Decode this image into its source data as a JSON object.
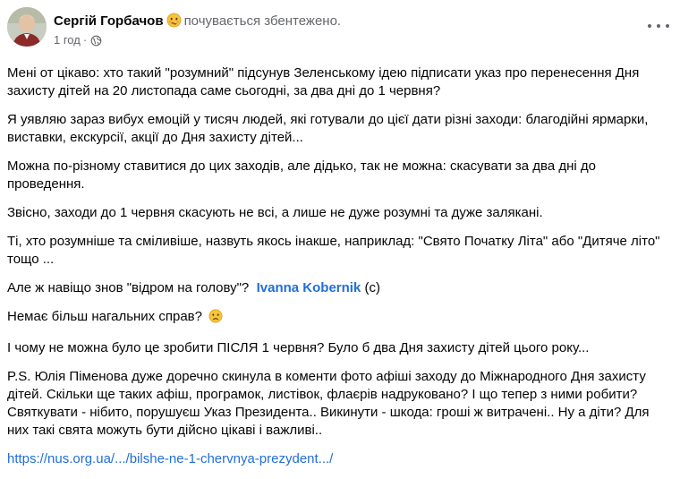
{
  "author": {
    "name": "Сергій Горбачов",
    "feeling": "почувається збентежено.",
    "feeling_emoji": "flustered-face",
    "time": "1 год",
    "visibility": "public-globe"
  },
  "post": {
    "p1": "Мені от цікаво: хто такий \"розумний\" підсунув Зеленському ідею підписати указ про перенесення Дня захисту дітей на 20 листопада саме сьогодні, за два дні до 1 червня?",
    "p2": "Я уявляю зараз вибух емоцій у тисяч людей, які готували до цієї дати різні заходи: благодійні ярмарки, виставки, екскурсії, акції до Дня захисту дітей...",
    "p3": "Можна по-різному ставитися до цих заходів, але дідько, так не можна: скасувати за два дні до проведення.",
    "p4": "Звісно, заходи до 1 червня скасують не всі, а лише не дуже розумні та дуже залякані.",
    "p5": "Ті, хто розумніше та сміливіше, назвуть якось інакше, наприклад: \"Свято Початку Літа\" або \"Дитяче літо\" тощо ...",
    "p6_before": "Але ж навіщо знов \"відром на голову\"?",
    "p6_mention": "Ivanna Kobernik",
    "p6_after": "(с)",
    "p7": "Немає більш нагальних справ?",
    "p7_emoji": "sad-face",
    "p8": "І чому не можна було це зробити ПІСЛЯ 1 червня? Було б два Дня захисту дітей цього року...",
    "p9": "P.S. Юлія Піменова дуже доречно скинула в коменти фото афіші  заходу до Міжнародного Дня захисту дітей. Скільки ще таких афіш, програмок, листівок, флаєрів надруковано? І що тепер з ними робити? Святкувати - нібито, порушуєш Указ Президента.. Викинути - шкода: гроші ж витрачені.. Ну а діти? Для них такі свята можуть бути дійсно цікаві і важливі..",
    "link": "https://nus.org.ua/.../bilshe-ne-1-chervnya-prezydent.../"
  },
  "colors": {
    "text": "#050505",
    "secondary": "#65676b",
    "link": "#216fdb",
    "background": "#ffffff"
  }
}
